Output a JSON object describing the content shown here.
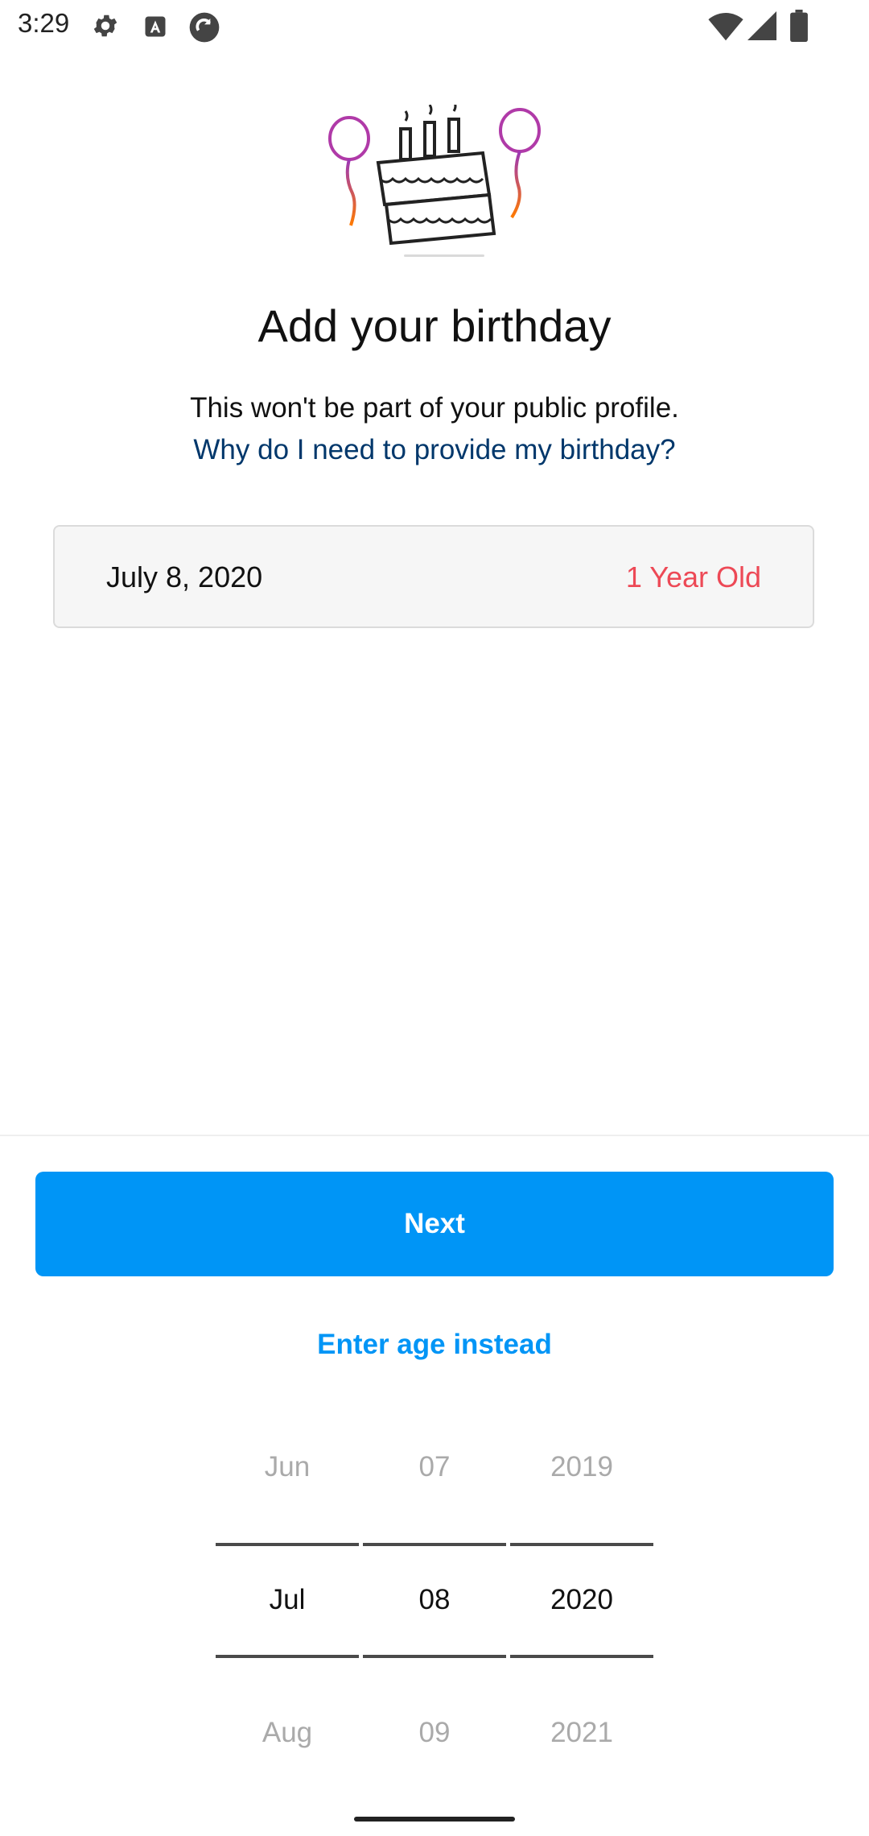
{
  "status_bar": {
    "time": "3:29",
    "icons": [
      "gear-icon",
      "text-a-icon",
      "sync-icon",
      "wifi-icon",
      "signal-icon",
      "battery-icon"
    ]
  },
  "header": {
    "illustration": "birthday-cake-illustration",
    "title": "Add your birthday",
    "subtitle": "This won't be part of your public profile.",
    "why_link": "Why do I need to provide my birthday?"
  },
  "date_field": {
    "value": "July 8, 2020",
    "age": "1 Year Old"
  },
  "actions": {
    "next_label": "Next",
    "enter_age_label": "Enter age instead"
  },
  "picker": {
    "month": {
      "prev": "Jun",
      "selected": "Jul",
      "next": "Aug"
    },
    "day": {
      "prev": "07",
      "selected": "08",
      "next": "09"
    },
    "year": {
      "prev": "2019",
      "selected": "2020",
      "next": "2021"
    }
  },
  "colors": {
    "primary_button": "#0095f6",
    "link": "#00376b",
    "age_text": "#ed4956"
  }
}
